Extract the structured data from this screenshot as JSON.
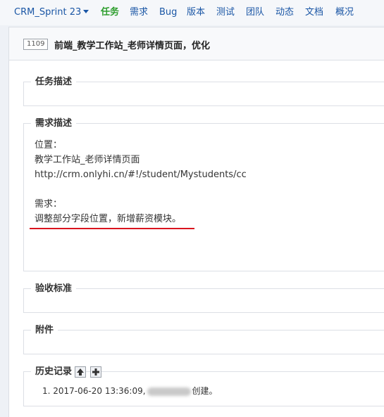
{
  "topnav": {
    "project": "CRM_Sprint 23",
    "items": [
      "任务",
      "需求",
      "Bug",
      "版本",
      "测试",
      "团队",
      "动态",
      "文档",
      "概况"
    ]
  },
  "task": {
    "id": "1109",
    "title": "前端_教学工作站_老师详情页面，优化"
  },
  "sections": {
    "task_desc": {
      "label": "任务描述"
    },
    "req_desc": {
      "label": "需求描述",
      "lines": [
        "位置：",
        "教学工作站_老师详情页面",
        "http://crm.onlyhi.cn/#!/student/Mystudents/cc",
        "",
        "需求：",
        "调整部分字段位置，新增薪资模块。"
      ]
    },
    "acceptance": {
      "label": "验收标准"
    },
    "attachments": {
      "label": "附件"
    },
    "history": {
      "label": "历史记录",
      "entry_prefix": "1. 2017-06-20 13:36:09,",
      "entry_suffix": "创建。"
    }
  },
  "colors": {
    "active_nav": "#2e9e2e",
    "link": "#1a56a5",
    "underline": "#d9141e"
  },
  "icons": {
    "collapse": "arrow-up-icon",
    "expand": "plus-icon"
  }
}
